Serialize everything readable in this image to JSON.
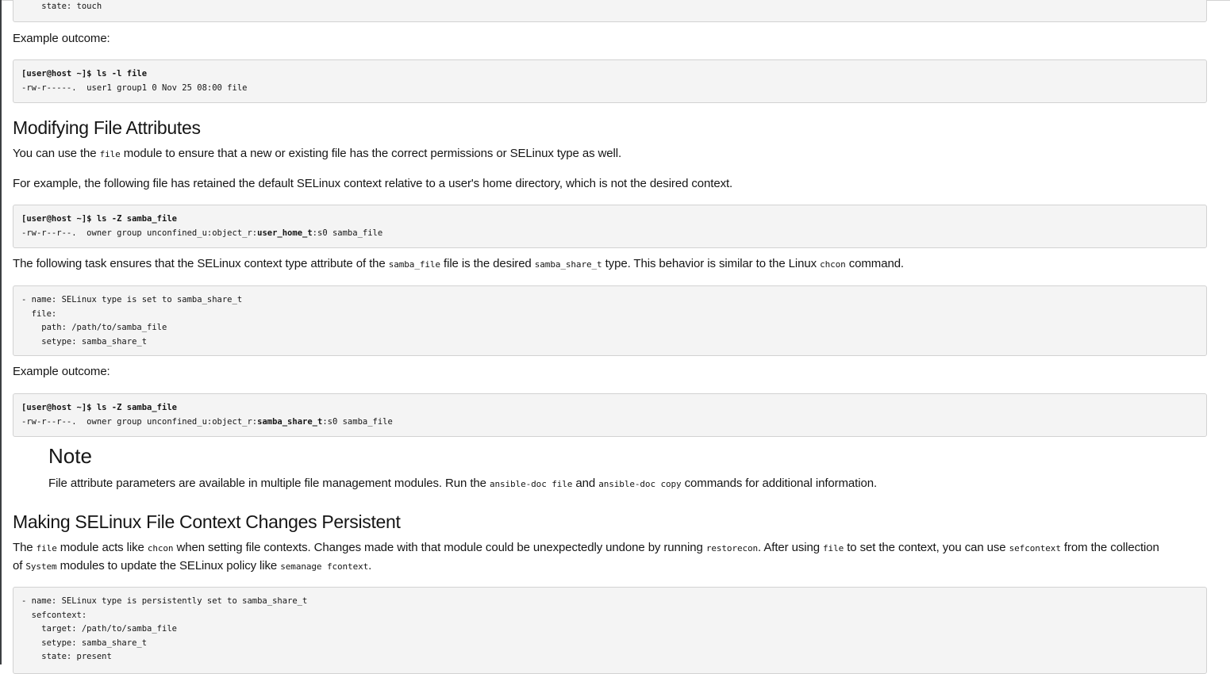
{
  "block0": {
    "lines": [
      "    state: touch"
    ]
  },
  "p_example1": "Example outcome:",
  "block1": {
    "prompt": "[user@host ~]$ ls -l file",
    "out": "-rw-r-----.  user1 group1 0 Nov 25 08:00 file"
  },
  "h_modifying": "Modifying File Attributes",
  "p_mod1": [
    "You can use the ",
    "file",
    " module to ensure that a new or existing file has the correct permissions or SELinux type as well."
  ],
  "p_mod2": "For example, the following file has retained the default SELinux context relative to a user's home directory, which is not the desired context.",
  "block2": {
    "prompt": "[user@host ~]$ ls -Z samba_file",
    "out_pre": "-rw-r--r--.  owner group unconfined_u:object_r:",
    "out_bold": "user_home_t",
    "out_post": ":s0 samba_file"
  },
  "p_task": [
    "The following task ensures that the SELinux context type attribute of the ",
    "samba_file",
    " file is the desired ",
    "samba_share_t",
    " type. This behavior is similar to the Linux ",
    "chcon",
    " command."
  ],
  "block3": {
    "lines": [
      "- name: SELinux type is set to samba_share_t",
      "  file:",
      "    path: /path/to/samba_file",
      "    setype: samba_share_t"
    ]
  },
  "p_example2": "Example outcome:",
  "block4": {
    "prompt": "[user@host ~]$ ls -Z samba_file",
    "out_pre": "-rw-r--r--.  owner group unconfined_u:object_r:",
    "out_bold": "samba_share_t",
    "out_post": ":s0 samba_file"
  },
  "note": {
    "title": "Note",
    "text": [
      "File attribute parameters are available in multiple file management modules. Run the ",
      "ansible-doc file",
      " and ",
      "ansible-doc copy",
      " commands for additional information."
    ]
  },
  "h_persistent": "Making SELinux File Context Changes Persistent",
  "p_persist": [
    "The ",
    "file",
    " module acts like ",
    "chcon",
    " when setting file contexts. Changes made with that module could be unexpectedly undone by running ",
    "restorecon",
    ". After using ",
    "file",
    " to set the context, you can use ",
    "sefcontext",
    " from the collection"
  ],
  "p_persist2": [
    "of ",
    "System",
    " modules to update the SELinux policy like ",
    "semanage fcontext",
    "."
  ],
  "block5": {
    "lines": [
      "- name: SELinux type is persistently set to samba_share_t",
      "  sefcontext:",
      "    target: /path/to/samba_file",
      "    setype: samba_share_t",
      "    state: present"
    ]
  }
}
